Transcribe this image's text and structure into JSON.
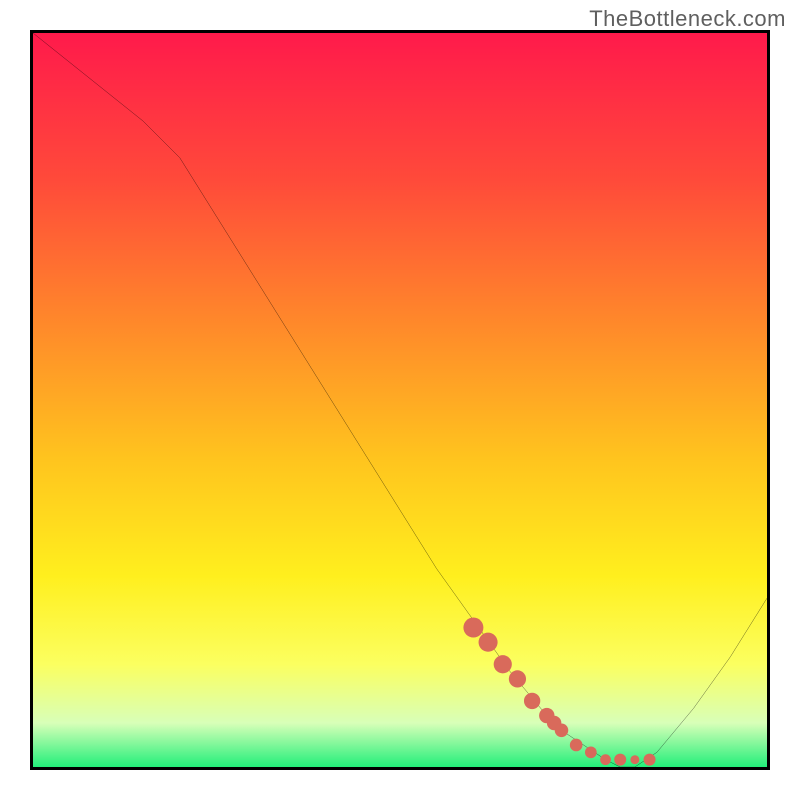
{
  "watermark": "TheBottleneck.com",
  "chart_data": {
    "type": "line",
    "title": "",
    "xlabel": "",
    "ylabel": "",
    "xlim": [
      0,
      100
    ],
    "ylim": [
      0,
      100
    ],
    "grid": false,
    "legend": false,
    "background_gradient": {
      "orientation": "vertical",
      "stops": [
        {
          "offset": 0.0,
          "color": "#ff1a4b"
        },
        {
          "offset": 0.2,
          "color": "#ff4a3a"
        },
        {
          "offset": 0.4,
          "color": "#ff8a2a"
        },
        {
          "offset": 0.58,
          "color": "#ffc41e"
        },
        {
          "offset": 0.74,
          "color": "#ffef1e"
        },
        {
          "offset": 0.86,
          "color": "#fbff60"
        },
        {
          "offset": 0.94,
          "color": "#d8ffb8"
        },
        {
          "offset": 1.0,
          "color": "#23ef7a"
        }
      ]
    },
    "series": [
      {
        "name": "main-curve",
        "type": "line",
        "color": "#000000",
        "width": 1.6,
        "x": [
          0,
          5,
          10,
          15,
          20,
          25,
          30,
          35,
          40,
          45,
          50,
          55,
          60,
          65,
          70,
          72,
          75,
          78,
          80,
          82,
          85,
          90,
          95,
          100
        ],
        "y": [
          100,
          96,
          92,
          88,
          83,
          75,
          67,
          59,
          51,
          43,
          35,
          27,
          20,
          13,
          7,
          5,
          3,
          1,
          0,
          0,
          2,
          8,
          15,
          23
        ]
      },
      {
        "name": "marker-trail",
        "type": "scatter",
        "color": "#d96a5b",
        "size_range": [
          4,
          10
        ],
        "x": [
          60,
          62,
          64,
          66,
          68,
          70,
          71,
          72,
          74,
          76,
          78,
          80,
          82,
          84
        ],
        "y": [
          19,
          17,
          14,
          12,
          9,
          7,
          6,
          5,
          3,
          2,
          1,
          1,
          1,
          1
        ]
      }
    ]
  }
}
